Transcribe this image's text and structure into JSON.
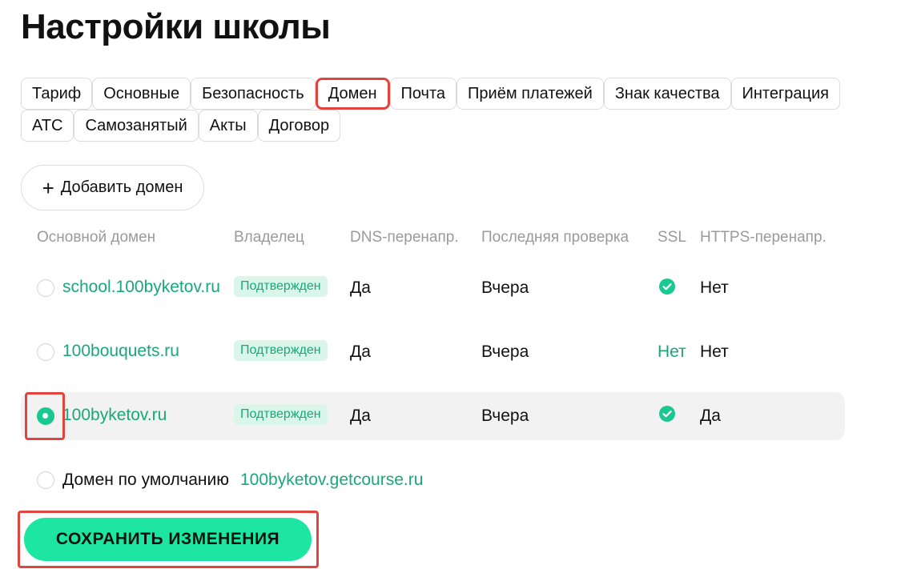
{
  "page": {
    "title": "Настройки школы"
  },
  "tabs": {
    "row1": [
      "Тариф",
      "Основные",
      "Безопасность",
      "Домен",
      "Почта",
      "Приём платежей",
      "Знак качества",
      "Интеграция"
    ],
    "row2": [
      "АТС",
      "Самозанятый",
      "Акты",
      "Договор"
    ],
    "active": "Домен"
  },
  "add_domain": {
    "label": "Добавить домен",
    "icon": "plus-icon"
  },
  "table": {
    "headers": {
      "domain": "Основной домен",
      "owner": "Владелец",
      "dns": "DNS-перенапр.",
      "last_check": "Последняя проверка",
      "ssl": "SSL",
      "https": "HTTPS-перенапр."
    },
    "rows": [
      {
        "domain": "school.100byketov.ru",
        "owner": "Подтвержден",
        "dns": "Да",
        "last_check": "Вчера",
        "ssl": "check-circle-icon",
        "ssl_text": "",
        "https": "Нет",
        "selected": false
      },
      {
        "domain": "100bouquets.ru",
        "owner": "Подтвержден",
        "dns": "Да",
        "last_check": "Вчера",
        "ssl": "",
        "ssl_text": "Нет",
        "https": "Нет",
        "selected": false
      },
      {
        "domain": "100byketov.ru",
        "owner": "Подтвержден",
        "dns": "Да",
        "last_check": "Вчера",
        "ssl": "check-circle-icon",
        "ssl_text": "",
        "https": "Да",
        "selected": true
      }
    ]
  },
  "default_domain": {
    "label": "Домен по умолчанию",
    "value": "100byketov.getcourse.ru"
  },
  "save": {
    "label": "СОХРАНИТЬ ИЗМЕНЕНИЯ"
  },
  "colors": {
    "accent": "#1de6a3",
    "link": "#19a878",
    "highlight": "#e0443e",
    "badge_bg": "#daf5ea"
  }
}
